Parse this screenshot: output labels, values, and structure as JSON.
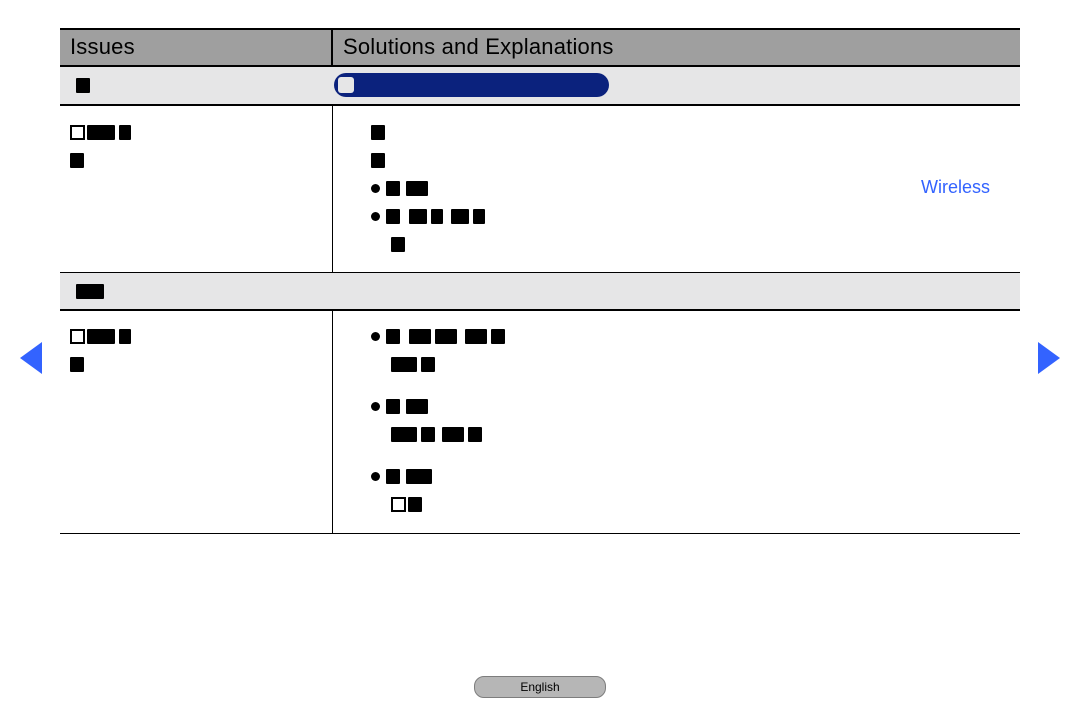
{
  "header": {
    "issues_label": "Issues",
    "solutions_label": "Solutions and Explanations"
  },
  "groups": [
    {
      "title": ""
    },
    {
      "title": ""
    }
  ],
  "rows": [
    {
      "issue": "",
      "highlight": "Wireless",
      "solution_lines": [
        "",
        "",
        "",
        ""
      ]
    },
    {
      "issue": "",
      "solution_lines": [
        "",
        "",
        "",
        "",
        ""
      ]
    }
  ],
  "language_button": "English",
  "nav": {
    "prev": "Previous page",
    "next": "Next page"
  },
  "colors": {
    "accent": "#3363ff",
    "pill": "#0b227d",
    "header_bg": "#9f9f9f",
    "group_bg": "#e6e6e7"
  }
}
